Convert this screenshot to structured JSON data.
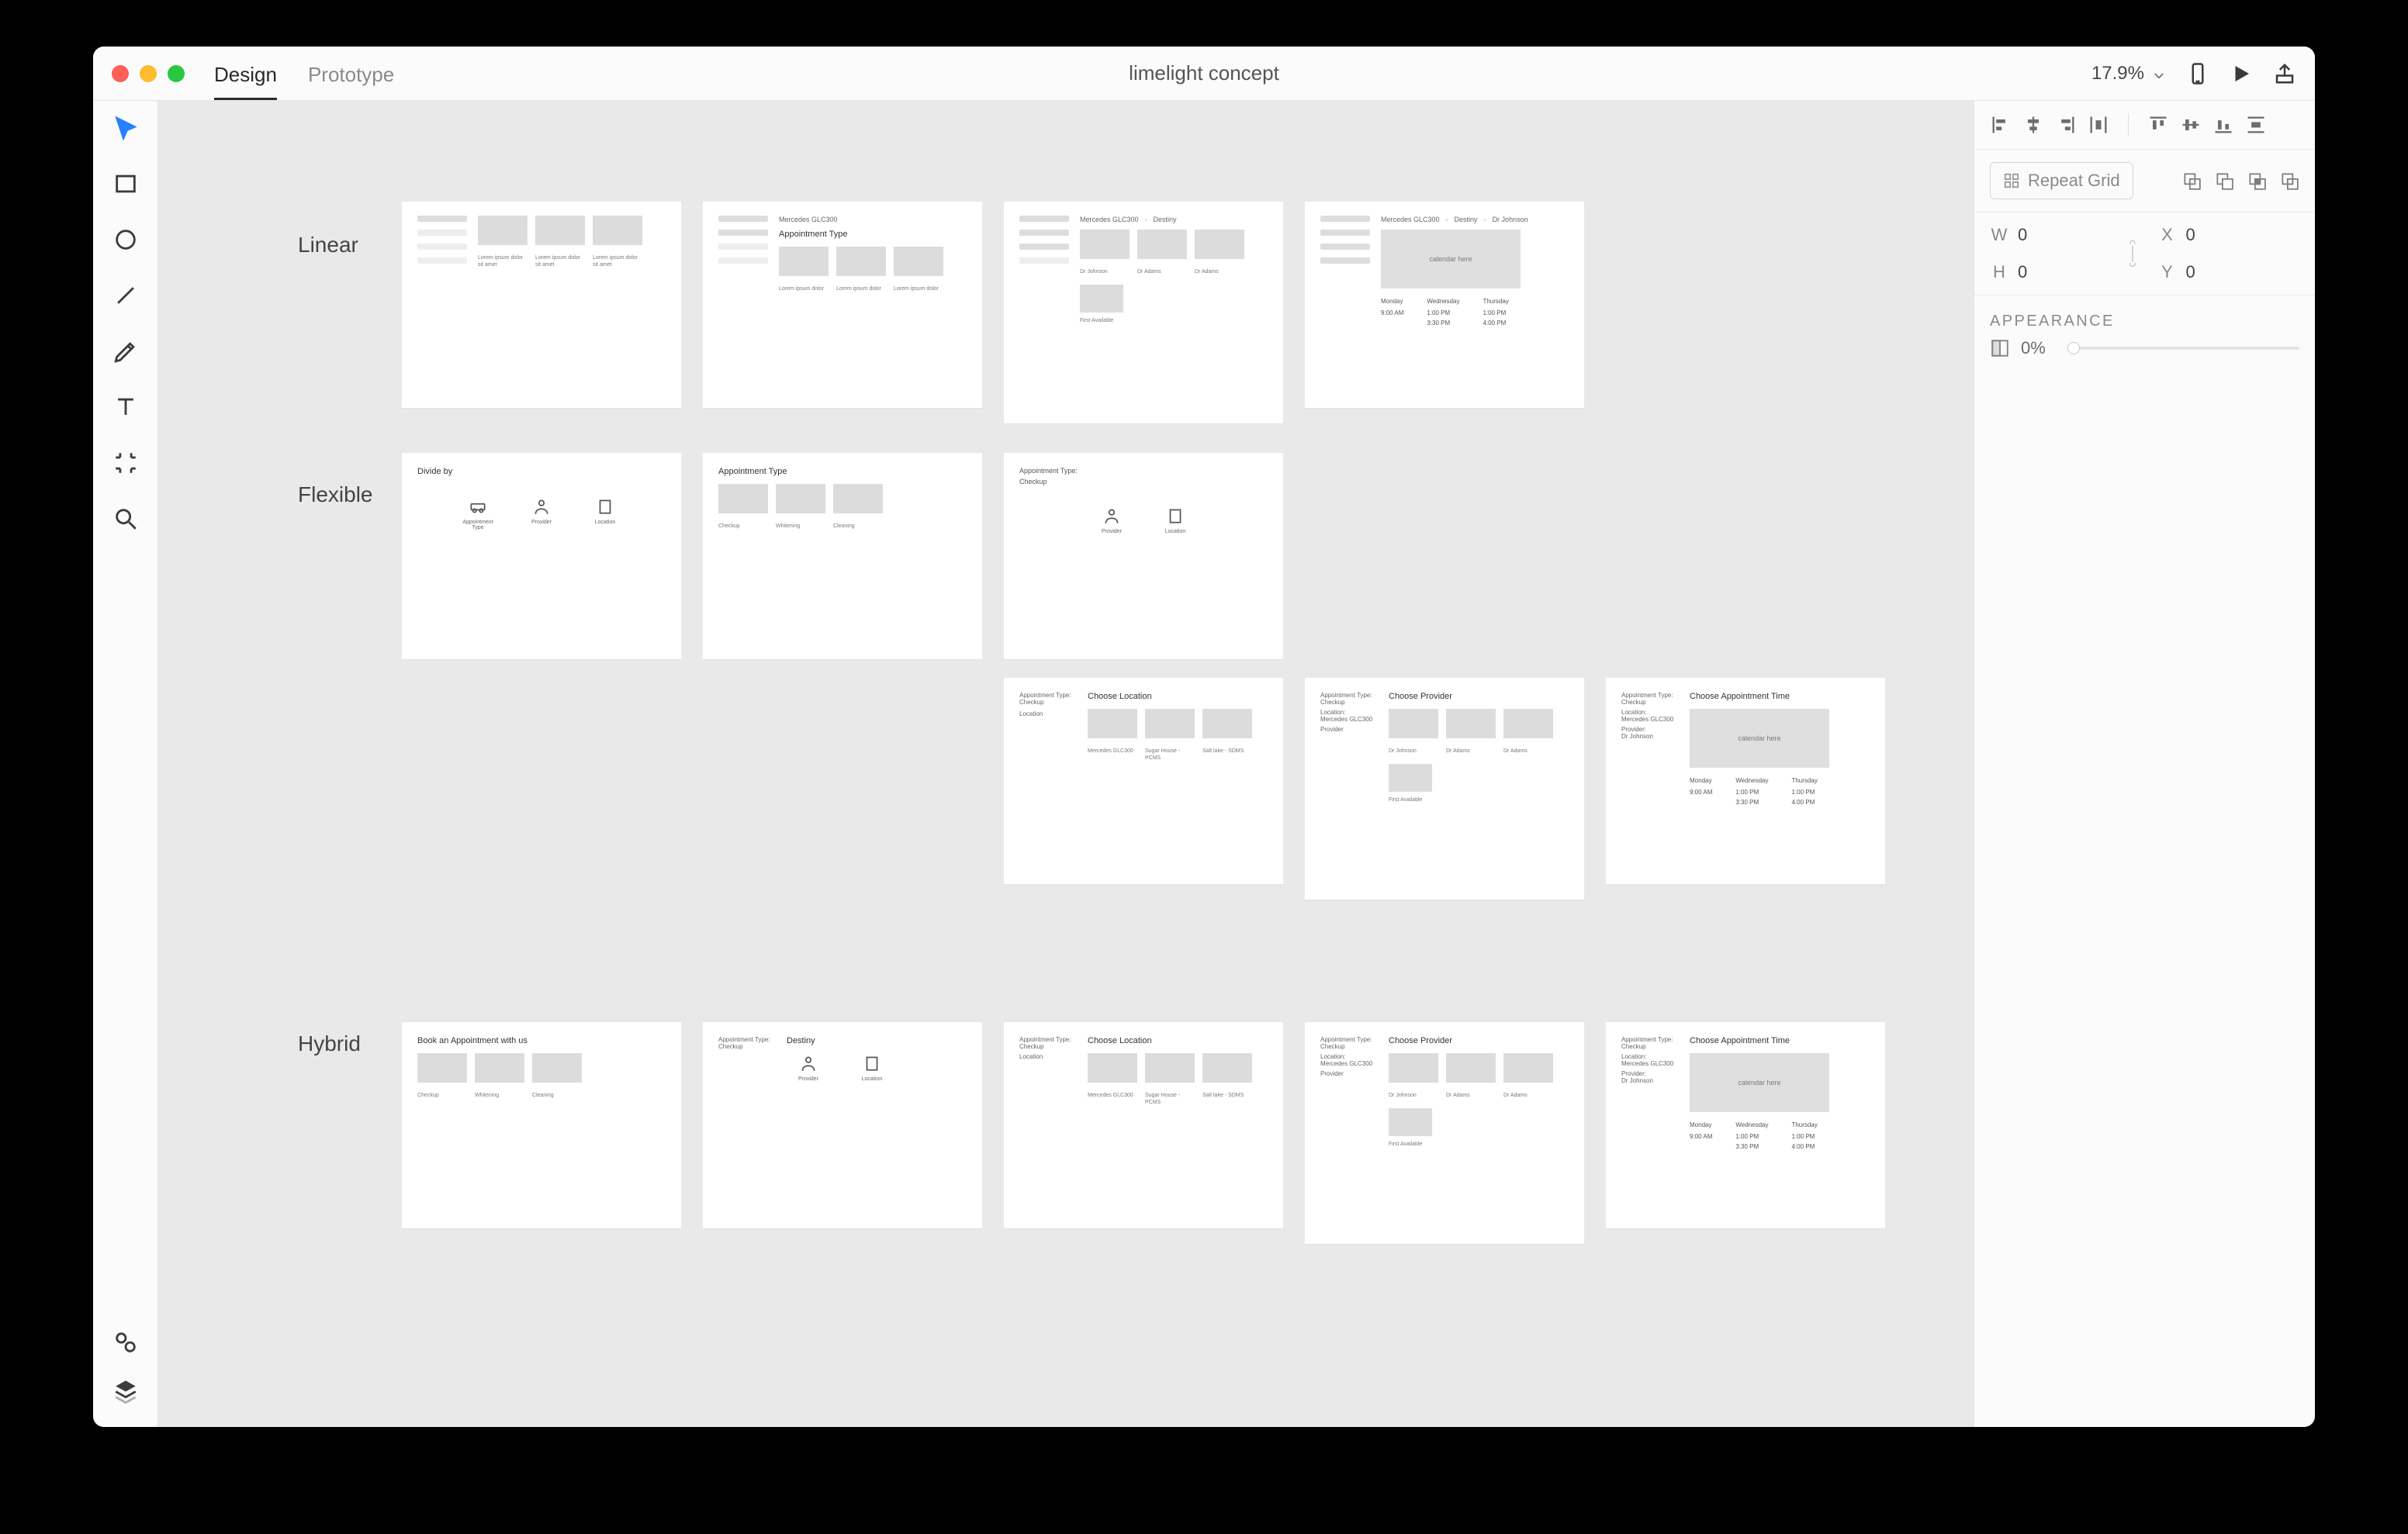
{
  "titlebar": {
    "tabs": {
      "design": "Design",
      "prototype": "Prototype"
    },
    "doc_title": "limelight concept",
    "zoom": "17.9%"
  },
  "inspector": {
    "repeat_grid": "Repeat Grid",
    "dims": {
      "w_label": "W",
      "w_val": "0",
      "x_label": "X",
      "x_val": "0",
      "h_label": "H",
      "h_val": "0",
      "y_label": "Y",
      "y_val": "0"
    },
    "appearance_head": "APPEARANCE",
    "opacity": "0%"
  },
  "sections": {
    "linear": "Linear",
    "flexible": "Flexible",
    "hybrid": "Hybrid"
  },
  "calendar_placeholder": "calendar here",
  "slots": {
    "day1": "Monday",
    "day2": "Wednesday",
    "day3": "Thursday",
    "t1": "9:00 AM",
    "t2": "1:00 PM",
    "t3": "1:00 PM",
    "t4": "3:30 PM",
    "t5": "4:00 PM"
  },
  "crumbs": {
    "c1": "Mercedes GLC300",
    "c2": "Destiny",
    "c3": "Dr Johnson"
  },
  "flex": {
    "divide": "Divide by",
    "appt_type": "Appointment Type",
    "provider": "Provider",
    "location": "Location"
  },
  "cards": {
    "appt_type": "Appointment Type:",
    "checkup": "Checkup",
    "choose_loc": "Choose Location",
    "choose_prov": "Choose Provider",
    "choose_time": "Choose Appointment Time",
    "loc_label": "Location:",
    "prov_label": "Provider:",
    "opt1": "Mercedes GLC300",
    "opt2": "Sugar House - PCMS",
    "opt3": "Salt lake - SDMS",
    "p1": "Dr Johnson",
    "p2": "Dr Adams",
    "p3": "Dr Adams",
    "first_avail": "First Available",
    "book_with": "Book an Appointment with us",
    "c_checkup": "Checkup",
    "c_whitening": "Whitening",
    "c_cleaning": "Cleaning",
    "destiny": "Destiny"
  }
}
